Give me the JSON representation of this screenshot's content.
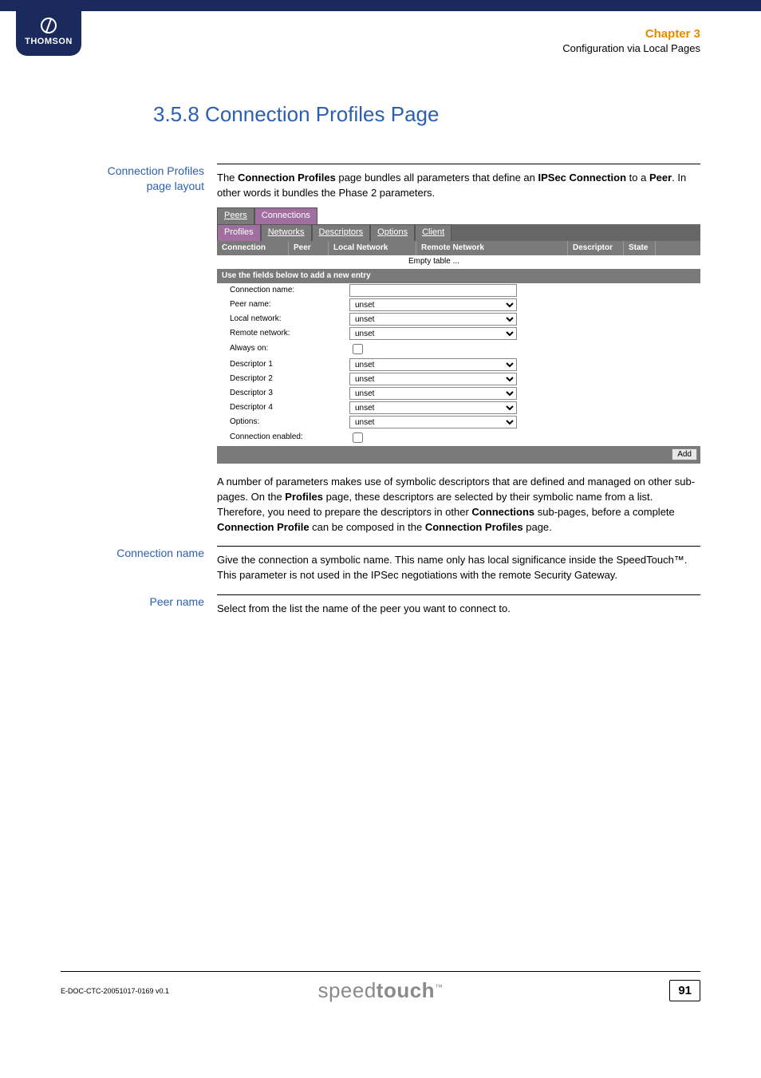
{
  "header": {
    "logo_text": "THOMSON",
    "chapter": "Chapter 3",
    "chapter_sub": "Configuration via Local Pages"
  },
  "title": "3.5.8  Connection Profiles Page",
  "sections": {
    "layout": {
      "label_l1": "Connection Profiles",
      "label_l2": "page layout",
      "para1_pre": "The ",
      "para1_b1": "Connection Profiles",
      "para1_mid1": " page bundles all parameters that define an ",
      "para1_b2": "IPSec Connection",
      "para1_mid2": " to a ",
      "para1_b3": "Peer",
      "para1_post": ". In other words it bundles the Phase 2 parameters.",
      "para2_a": "A number of parameters makes use of symbolic descriptors that are defined and managed on other sub-pages. On the ",
      "para2_b1": "Profiles",
      "para2_b": " page, these descriptors are selected by their symbolic name from a list. Therefore, you need to prepare the descriptors in other ",
      "para2_b2": "Connections",
      "para2_c": " sub-pages, before a complete ",
      "para2_b3": "Connection Profile",
      "para2_d": " can be composed in the ",
      "para2_b4": "Connection Profiles",
      "para2_e": " page."
    },
    "conn_name": {
      "label": "Connection name",
      "text": "Give the connection a symbolic name. This name only has local significance inside the SpeedTouch™. This parameter is not used in the IPSec negotiations with the remote Security Gateway."
    },
    "peer_name": {
      "label": "Peer name",
      "text": "Select from the list the name of the peer you want to connect to."
    }
  },
  "embed": {
    "tabs": [
      "Peers",
      "Connections"
    ],
    "tabs_active": 1,
    "subtabs": [
      "Profiles",
      "Networks",
      "Descriptors",
      "Options",
      "Client"
    ],
    "subtabs_active": 0,
    "columns": [
      "Connection",
      "Peer",
      "Local Network",
      "Remote Network",
      "Descriptor",
      "State"
    ],
    "empty_text": "Empty table ...",
    "form_header": "Use the fields below to add a new entry",
    "fields": [
      {
        "label": "Connection name:",
        "type": "text",
        "value": ""
      },
      {
        "label": "Peer name:",
        "type": "select",
        "value": "unset"
      },
      {
        "label": "Local network:",
        "type": "select",
        "value": "unset"
      },
      {
        "label": "Remote network:",
        "type": "select",
        "value": "unset"
      },
      {
        "label": "Always on:",
        "type": "checkbox"
      },
      {
        "label": "Descriptor 1",
        "type": "select",
        "value": "unset"
      },
      {
        "label": "Descriptor 2",
        "type": "select",
        "value": "unset"
      },
      {
        "label": "Descriptor 3",
        "type": "select",
        "value": "unset"
      },
      {
        "label": "Descriptor 4",
        "type": "select",
        "value": "unset"
      },
      {
        "label": "Options:",
        "type": "select",
        "value": "unset"
      },
      {
        "label": "Connection enabled:",
        "type": "checkbox"
      }
    ],
    "add_label": "Add"
  },
  "footer": {
    "docid": "E-DOC-CTC-20051017-0169 v0.1",
    "brand_pre": "speed",
    "brand_bold": "touch",
    "brand_tm": "™",
    "page": "91"
  }
}
